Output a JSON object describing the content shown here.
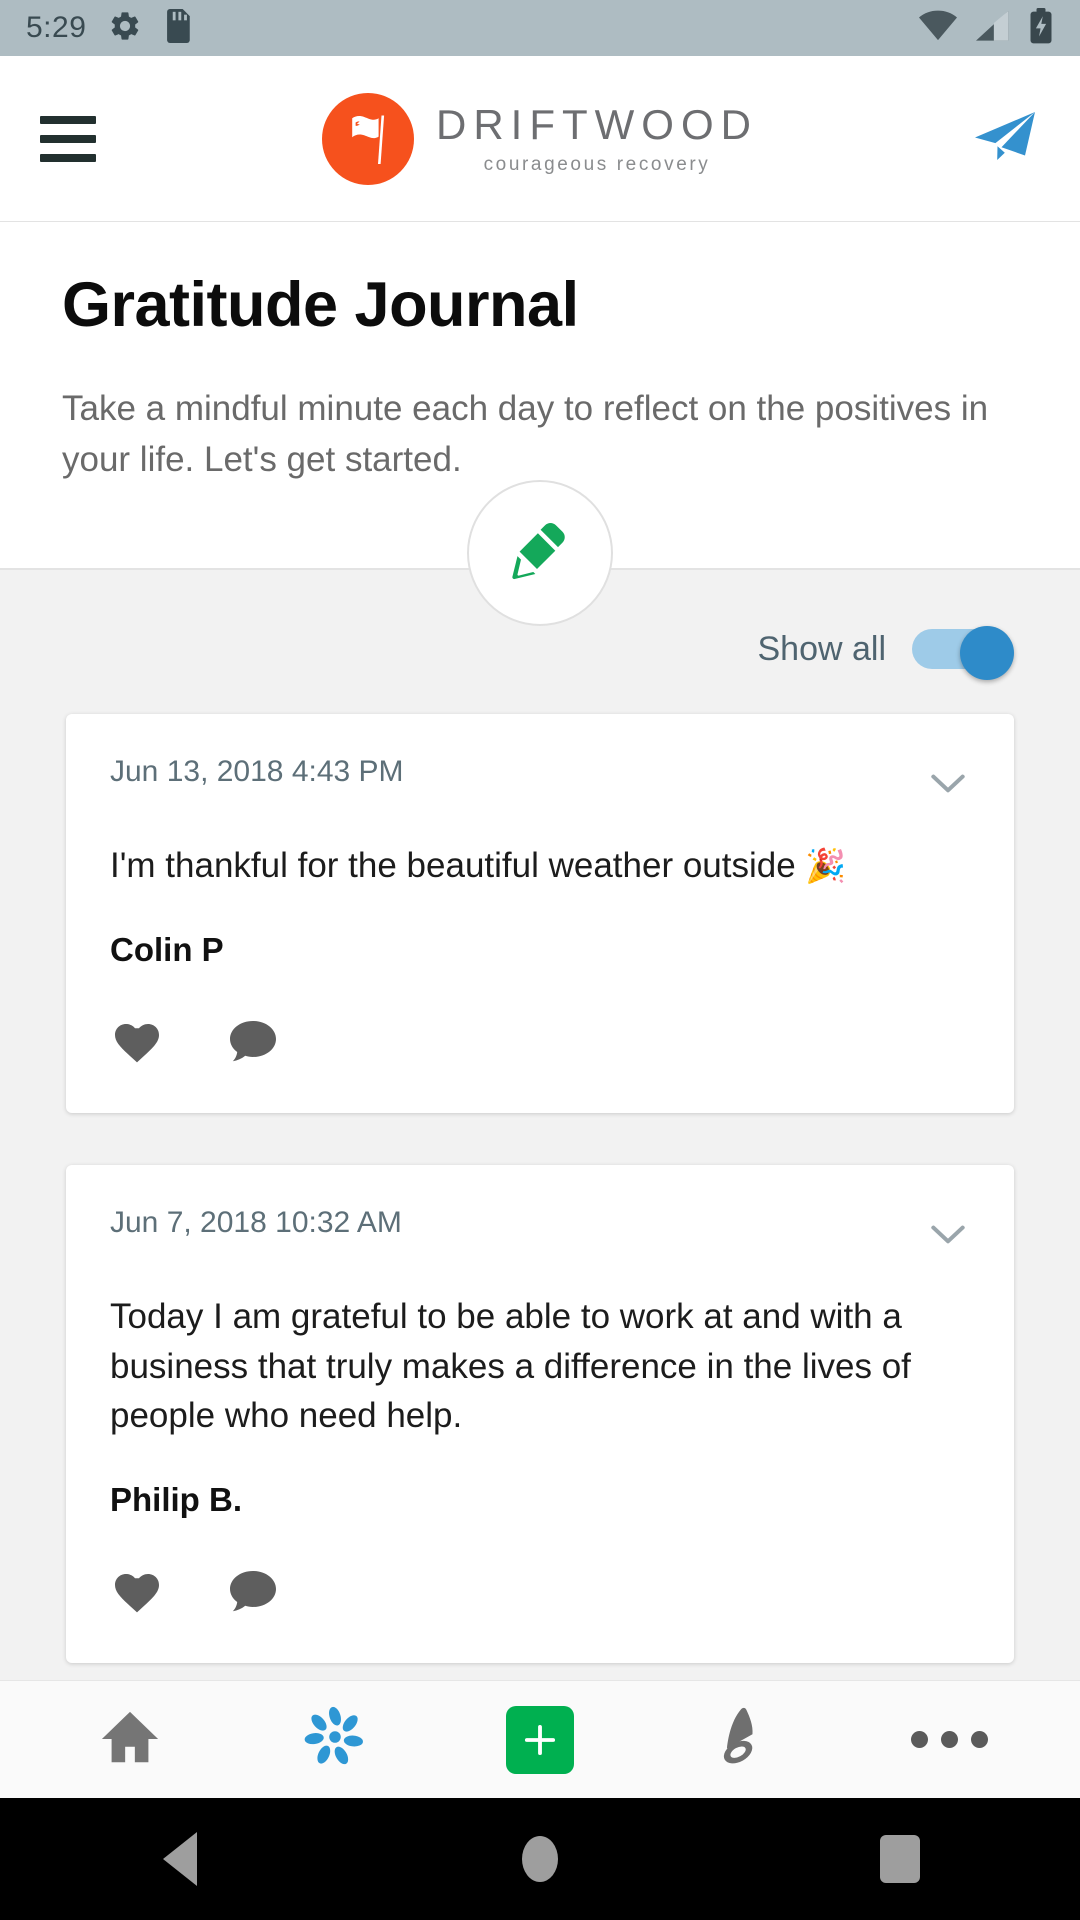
{
  "statusbar": {
    "time": "5:29",
    "left_icons": [
      "gear-icon",
      "sd-card-icon"
    ],
    "right_icons": [
      "wifi-icon",
      "cell-signal-icon",
      "battery-charging-icon"
    ],
    "background": "#aebcc2"
  },
  "header": {
    "menu_icon": "hamburger-menu-icon",
    "brand_name": "DRIFTWOOD",
    "brand_tagline": "courageous recovery",
    "brand_color": "#f6511d",
    "send_icon": "send-paper-plane-icon",
    "send_color": "#3491ce"
  },
  "intro": {
    "title": "Gratitude Journal",
    "description": "Take a mindful minute each day to reflect on the positives in your life. Let's get started."
  },
  "compose": {
    "icon": "pencil-edit-icon",
    "icon_color": "#14a85a",
    "label": "New entry"
  },
  "filter": {
    "show_all_label": "Show all",
    "show_all_enabled": true,
    "track_color": "#9ecbe8",
    "thumb_color": "#2e8bc9"
  },
  "entries": [
    {
      "date": "Jun 13, 2018 4:43 PM",
      "text": "I'm thankful for the beautiful weather outside ",
      "emoji": "🎉",
      "author": "Colin P",
      "like_icon": "heart-icon",
      "comment_icon": "comment-bubble-icon",
      "expand_icon": "chevron-down-icon"
    },
    {
      "date": "Jun 7, 2018 10:32 AM",
      "text": "Today I am grateful to be able to work at and with a business that truly makes a difference in the lives of people who need help.",
      "emoji": "",
      "author": "Philip B.",
      "like_icon": "heart-icon",
      "comment_icon": "comment-bubble-icon",
      "expand_icon": "chevron-down-icon"
    }
  ],
  "bottom_nav": [
    {
      "name": "home",
      "icon": "home-icon",
      "color": "#757575"
    },
    {
      "name": "wellness",
      "icon": "pinwheel-flower-icon",
      "color": "#2e97d4"
    },
    {
      "name": "add",
      "icon": "plus-icon",
      "color": "#00b050"
    },
    {
      "name": "notifications",
      "icon": "bell-icon",
      "color": "#6f6f6f"
    },
    {
      "name": "more",
      "icon": "more-dots-icon",
      "color": "#5a5a5a"
    }
  ],
  "android_nav": {
    "back": "back-triangle-icon",
    "home": "home-circle-icon",
    "recents": "recents-square-icon"
  }
}
